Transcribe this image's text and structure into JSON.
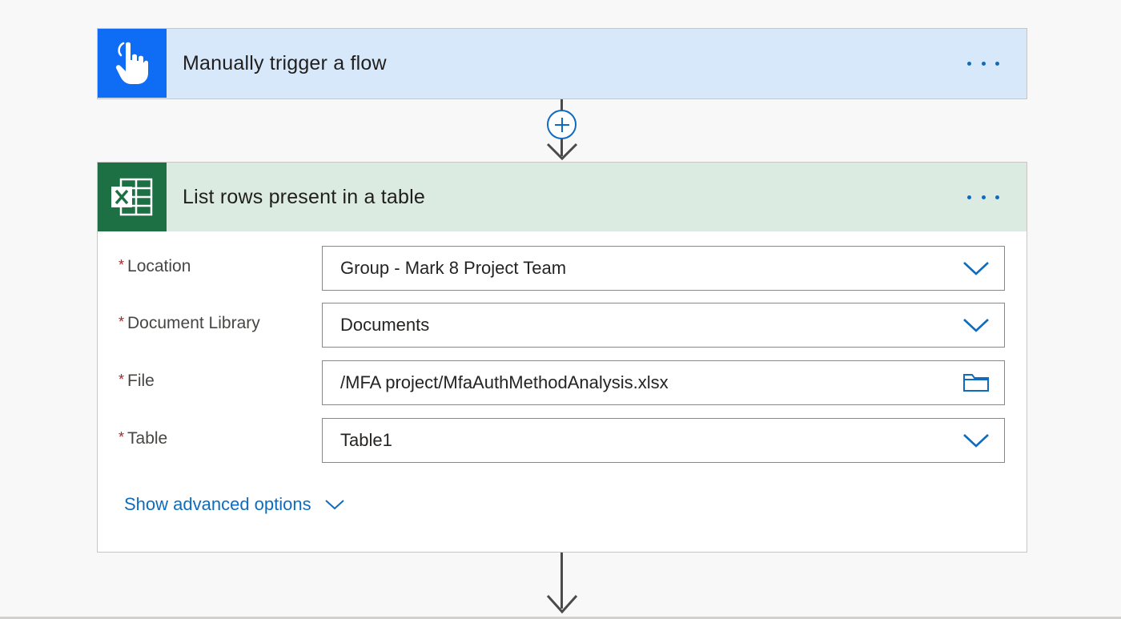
{
  "trigger": {
    "title": "Manually trigger a flow",
    "icon": "hand-pointer-icon",
    "color": "#0f6cf5"
  },
  "action": {
    "title": "List rows present in a table",
    "icon": "excel-icon",
    "color": "#1d7044",
    "fields": [
      {
        "label": "Location",
        "required": "*",
        "value": "Group - Mark 8 Project Team",
        "control": "dropdown"
      },
      {
        "label": "Document Library",
        "required": "*",
        "value": "Documents",
        "control": "dropdown"
      },
      {
        "label": "File",
        "required": "*",
        "value": "/MFA project/MfaAuthMethodAnalysis.xlsx",
        "control": "folder-picker"
      },
      {
        "label": "Table",
        "required": "*",
        "value": "Table1",
        "control": "dropdown"
      }
    ],
    "advanced_label": "Show advanced options"
  },
  "accent": "#0f6cbd"
}
